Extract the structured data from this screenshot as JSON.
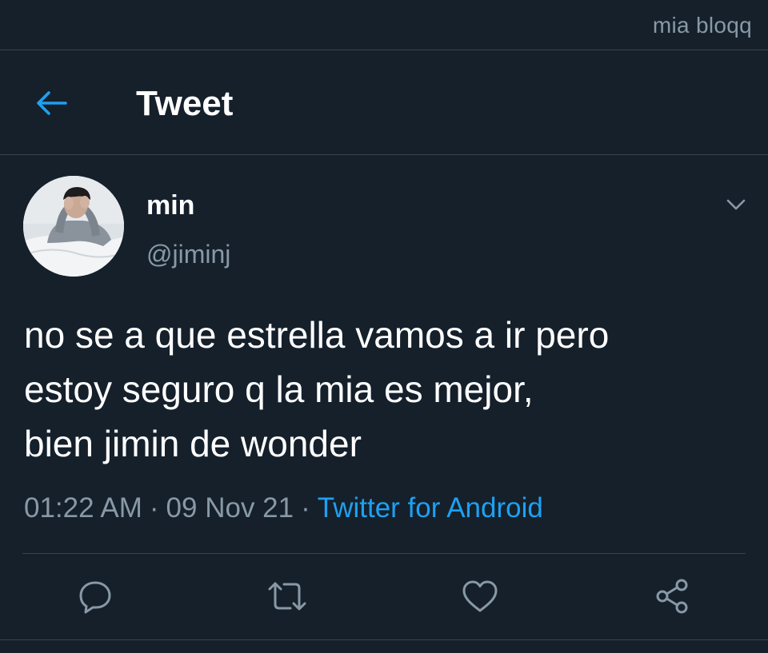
{
  "watermark": "mia bloqq",
  "header": {
    "title": "Tweet",
    "back_icon": "arrow-left-icon"
  },
  "tweet": {
    "author": {
      "display_name": "min",
      "handle": "@jiminj",
      "avatar": "avatar-photo"
    },
    "text": "no se a que estrella vamos a ir pero\nestoy seguro q la mia es mejor,\nbien jimin de wonder",
    "time": "01:22 AM",
    "date": "09 Nov 21",
    "source": "Twitter for Android",
    "separator": "·"
  },
  "actions": {
    "reply_icon": "reply-icon",
    "retweet_icon": "retweet-icon",
    "like_icon": "heart-icon",
    "share_icon": "share-icon"
  },
  "colors": {
    "background": "#15202b",
    "border": "#38444d",
    "muted_text": "#8899a6",
    "accent": "#1da1f2",
    "text": "#ffffff"
  }
}
